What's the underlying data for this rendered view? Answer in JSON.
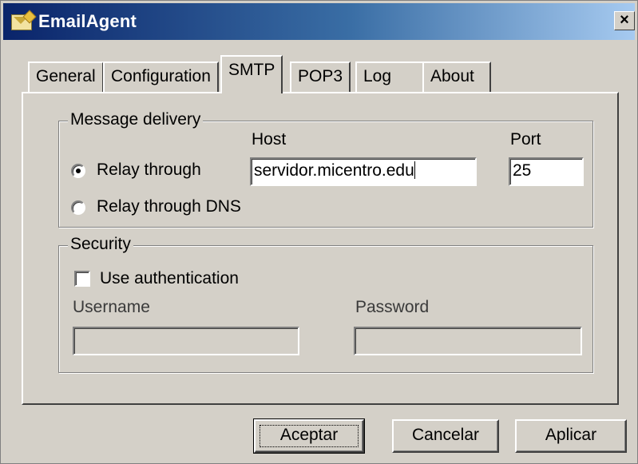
{
  "window": {
    "title": "EmailAgent",
    "close_glyph": "×",
    "titlebar_color_start": "#0a246a",
    "titlebar_color_end": "#a6caf0",
    "face_color": "#d4d0c8"
  },
  "tabs": [
    {
      "label": "General",
      "active": false
    },
    {
      "label": "Configuration",
      "active": false
    },
    {
      "label": "SMTP",
      "active": true
    },
    {
      "label": "POP3",
      "active": false
    },
    {
      "label": "Log",
      "active": false
    },
    {
      "label": "About",
      "active": false
    }
  ],
  "delivery": {
    "legend": "Message delivery",
    "host_label": "Host",
    "port_label": "Port",
    "relay_label": "Relay through",
    "relay_selected": true,
    "dns_label": "Relay through DNS",
    "dns_selected": false,
    "host_value": "servidor.micentro.edu",
    "port_value": "25"
  },
  "security": {
    "legend": "Security",
    "auth_label": "Use authentication",
    "auth_checked": false,
    "username_label": "Username",
    "username_value": "",
    "password_label": "Password",
    "password_value": ""
  },
  "buttons": {
    "ok": "Aceptar",
    "cancel": "Cancelar",
    "apply": "Aplicar"
  }
}
